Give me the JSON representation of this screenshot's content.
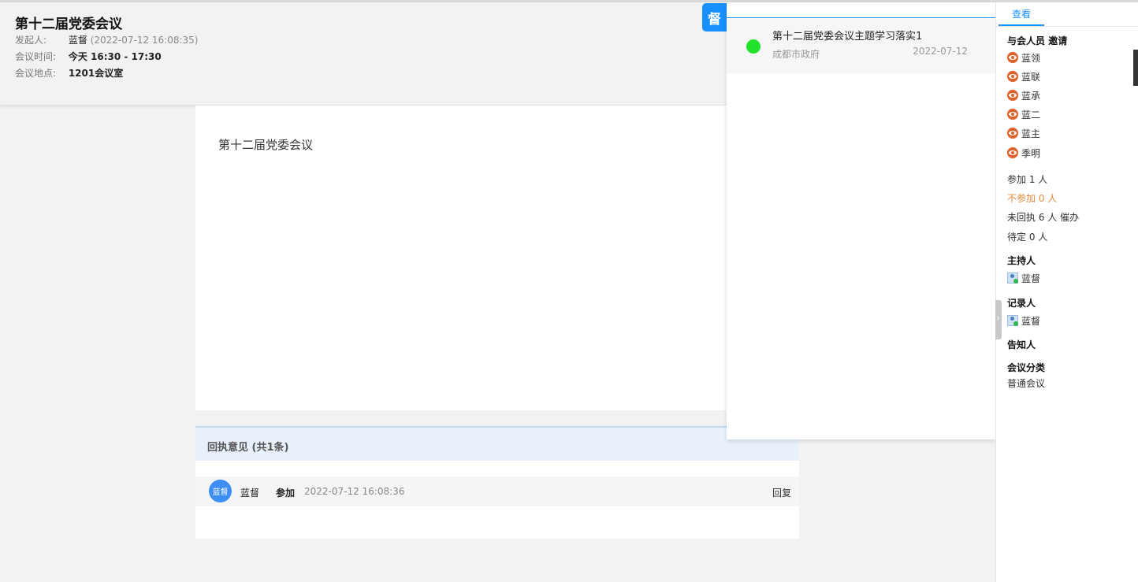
{
  "header": {
    "title": "第十二届党委会议",
    "initiator_label": "发起人:",
    "initiator_name": "蓝督",
    "initiator_time": "(2022-07-12 16:08:35)",
    "time_label": "会议时间:",
    "time_value": "今天 16:30 - 17:30",
    "location_label": "会议地点:",
    "location_value": "1201会议室",
    "badge": "督"
  },
  "content": {
    "text": "第十二届党委会议"
  },
  "replies": {
    "title": "回执意见 (共1条)",
    "items": [
      {
        "avatar": "蓝督",
        "name": "蓝督",
        "status": "参加",
        "time": "2022-07-12 16:08:36",
        "action": "回复"
      }
    ]
  },
  "popup": {
    "items": [
      {
        "title": "第十二届党委会议主题学习落实1",
        "org": "成都市政府",
        "date": "2022-07-12"
      }
    ]
  },
  "sidebar": {
    "tab": "查看",
    "attendees_title": "与会人员",
    "invite": "邀请",
    "attendees": [
      "蓝领",
      "蓝联",
      "蓝承",
      "蓝二",
      "蓝主",
      "季明"
    ],
    "stats": {
      "join": "参加 1 人",
      "decline": "不参加 0 人",
      "no_reply": "未回执 6 人 催办",
      "pending": "待定 0 人"
    },
    "host_title": "主持人",
    "host": "蓝督",
    "recorder_title": "记录人",
    "recorder": "蓝督",
    "notify_title": "告知人",
    "category_title": "会议分类",
    "category": "普通会议"
  },
  "colors": {
    "accent": "#1890ff",
    "online_dot": "#22e22c",
    "decline": "#e08a3c"
  }
}
